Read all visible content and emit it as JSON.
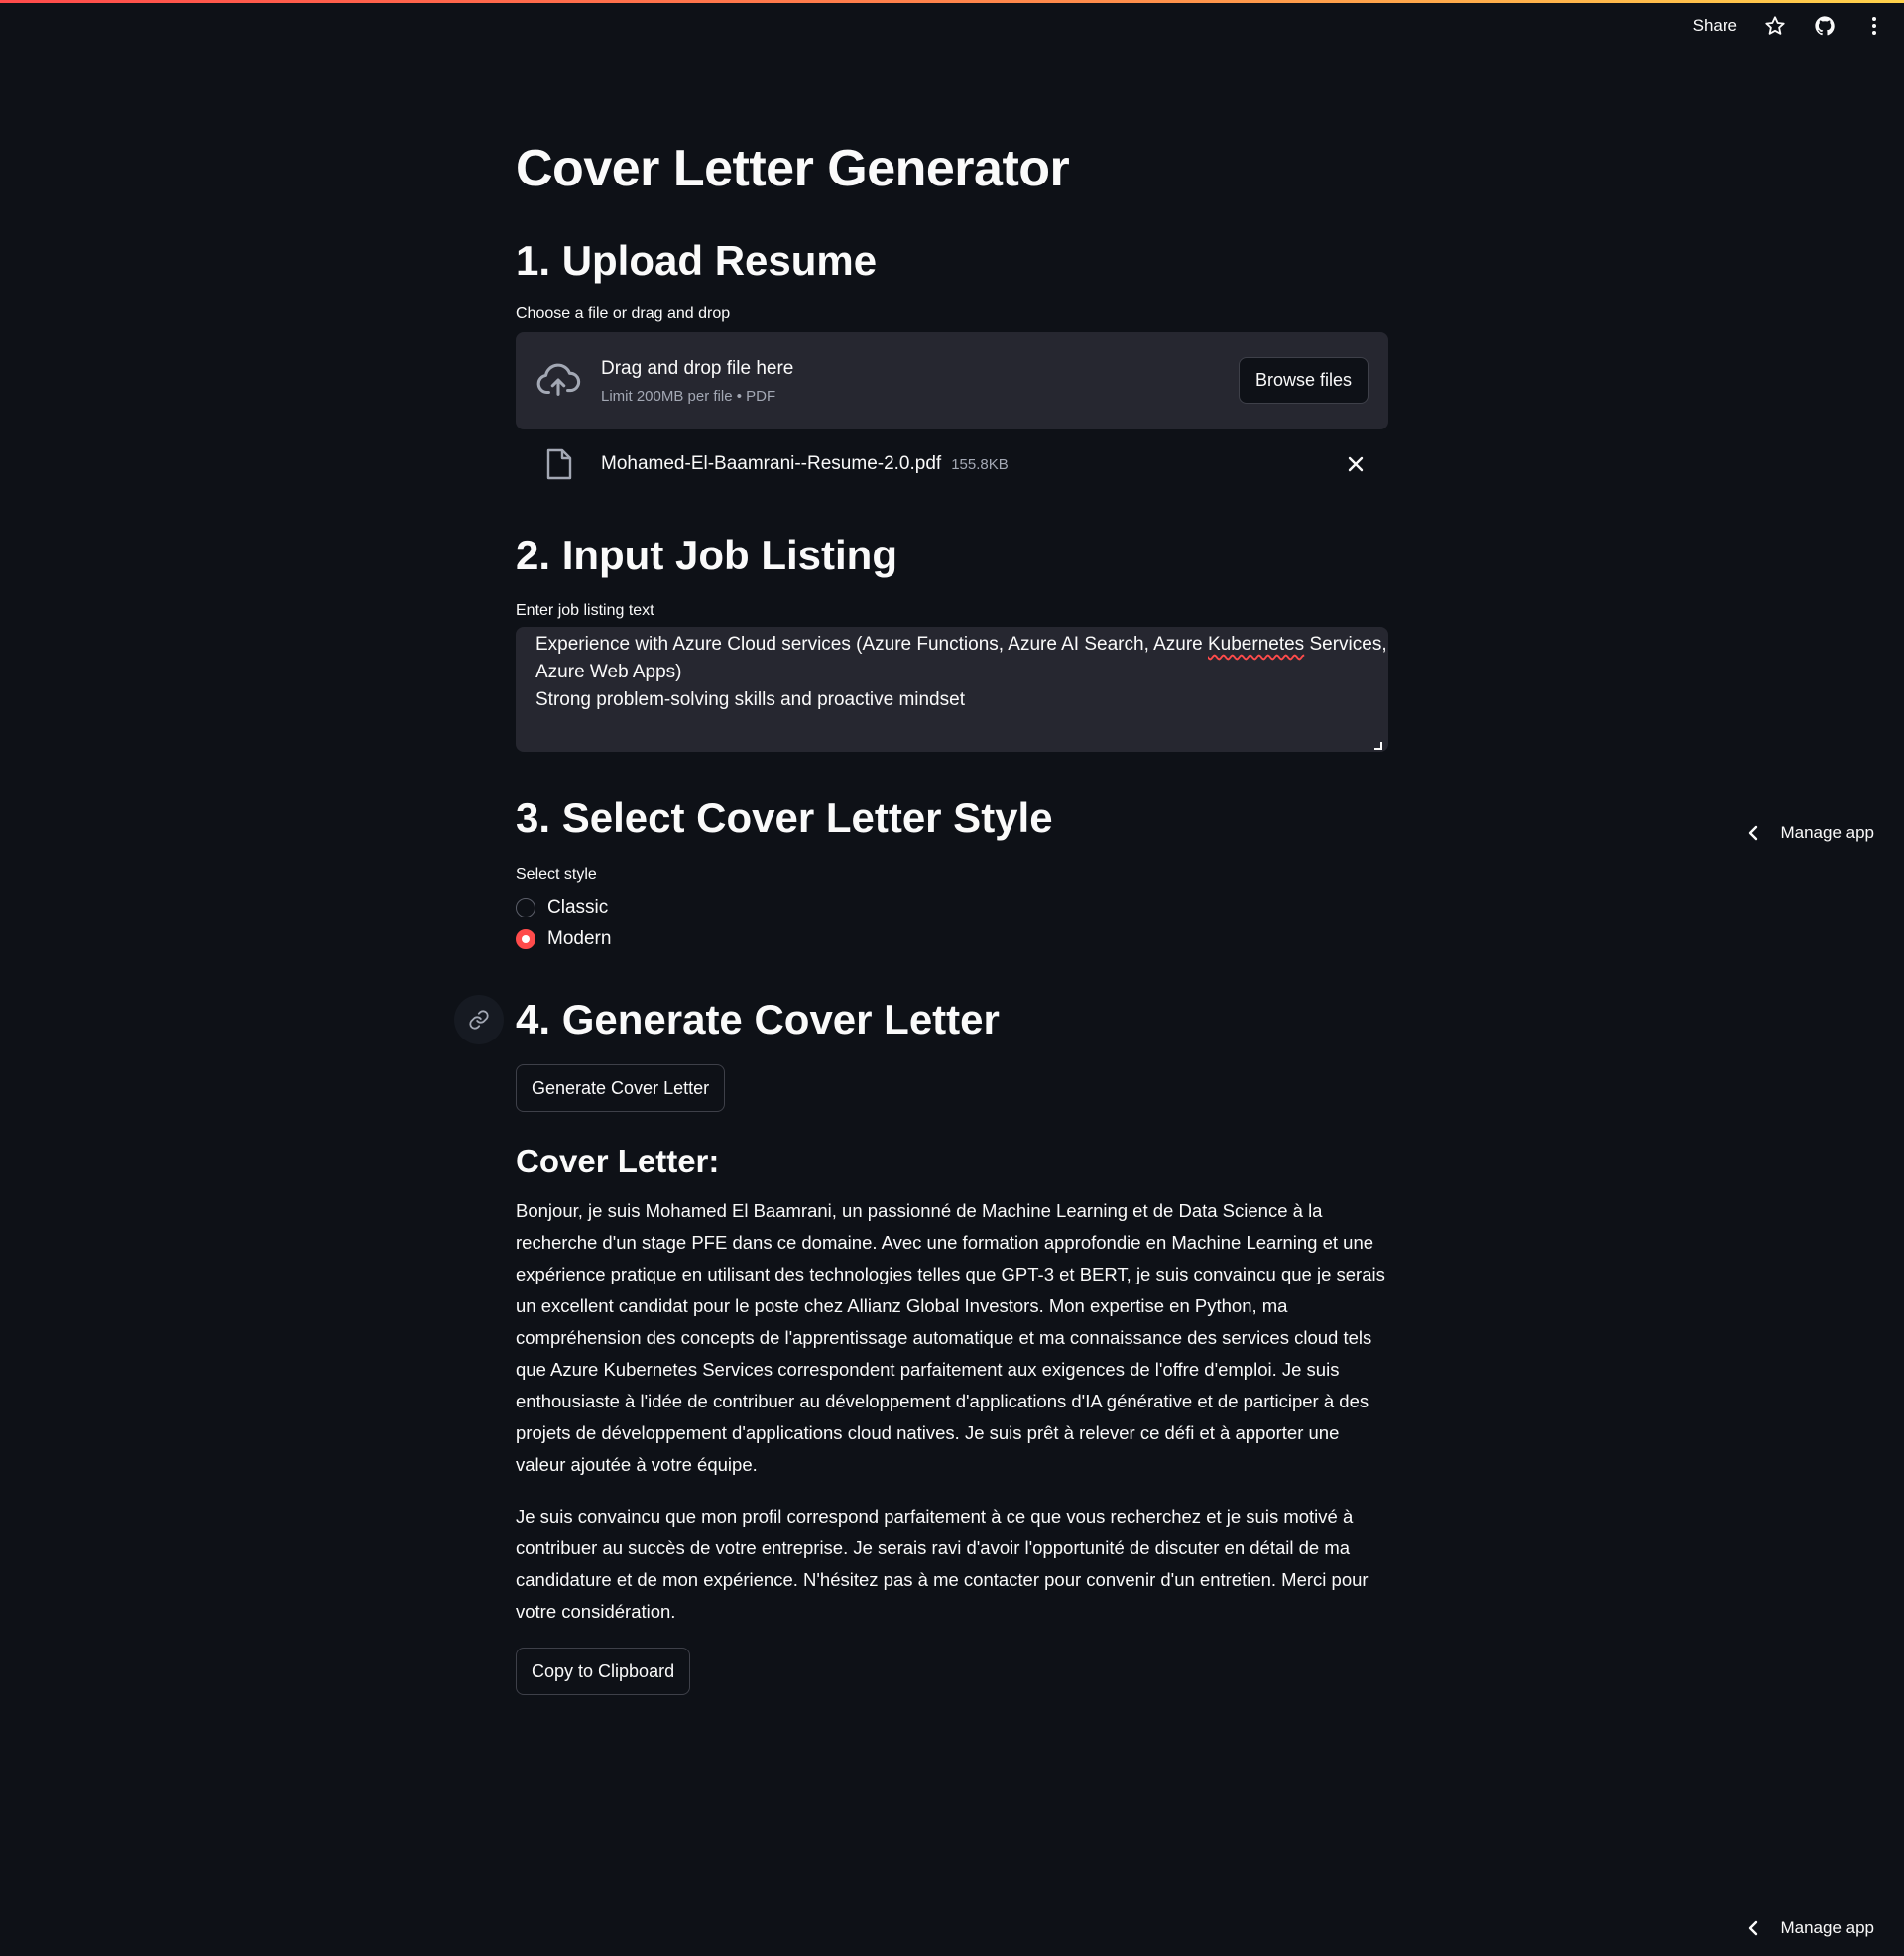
{
  "header": {
    "share_label": "Share",
    "icons": [
      "star-icon",
      "github-icon",
      "more-vertical-icon"
    ]
  },
  "page": {
    "title": "Cover Letter Generator"
  },
  "upload": {
    "heading": "1. Upload Resume",
    "label": "Choose a file or drag and drop",
    "drop_text": "Drag and drop file here",
    "limit_text": "Limit 200MB per file • PDF",
    "browse_label": "Browse files",
    "file_name": "Mohamed-El-Baamrani--Resume-2.0.pdf",
    "file_size": "155.8KB"
  },
  "job": {
    "heading": "2. Input Job Listing",
    "label": "Enter job listing text",
    "text_line1_a": "Experience with Azure Cloud services (Azure Functions, Azure AI Search, Azure ",
    "text_line1_spell": "Kubernetes",
    "text_line1_b": " Services,",
    "text_line2": "Azure Web Apps)",
    "text_line3": "Strong problem-solving skills and proactive mindset"
  },
  "style": {
    "heading": "3. Select Cover Letter Style",
    "label": "Select style",
    "options": [
      "Classic",
      "Modern"
    ],
    "selected": "Modern"
  },
  "generate": {
    "heading": "4. Generate Cover Letter",
    "button_label": "Generate Cover Letter"
  },
  "cover_letter": {
    "heading": "Cover Letter:",
    "paragraph1": "Bonjour, je suis Mohamed El Baamrani, un passionné de Machine Learning et de Data Science à la recherche d'un stage PFE dans ce domaine. Avec une formation approfondie en Machine Learning et une expérience pratique en utilisant des technologies telles que GPT-3 et BERT, je suis convaincu que je serais un excellent candidat pour le poste chez Allianz Global Investors. Mon expertise en Python, ma compréhension des concepts de l'apprentissage automatique et ma connaissance des services cloud tels que Azure Kubernetes Services correspondent parfaitement aux exigences de l'offre d'emploi. Je suis enthousiaste à l'idée de contribuer au développement d'applications d'IA générative et de participer à des projets de développement d'applications cloud natives. Je suis prêt à relever ce défi et à apporter une valeur ajoutée à votre équipe.",
    "paragraph2": "Je suis convaincu que mon profil correspond parfaitement à ce que vous recherchez et je suis motivé à contribuer au succès de votre entreprise. Je serais ravi d'avoir l'opportunité de discuter en détail de ma candidature et de mon expérience. N'hésitez pas à me contacter pour convenir d'un entretien. Merci pour votre considération.",
    "copy_label": "Copy to Clipboard"
  },
  "manage": {
    "label": "Manage app"
  },
  "colors": {
    "background": "#0e1117",
    "surface": "#262730",
    "accent": "#ff4b4b"
  }
}
